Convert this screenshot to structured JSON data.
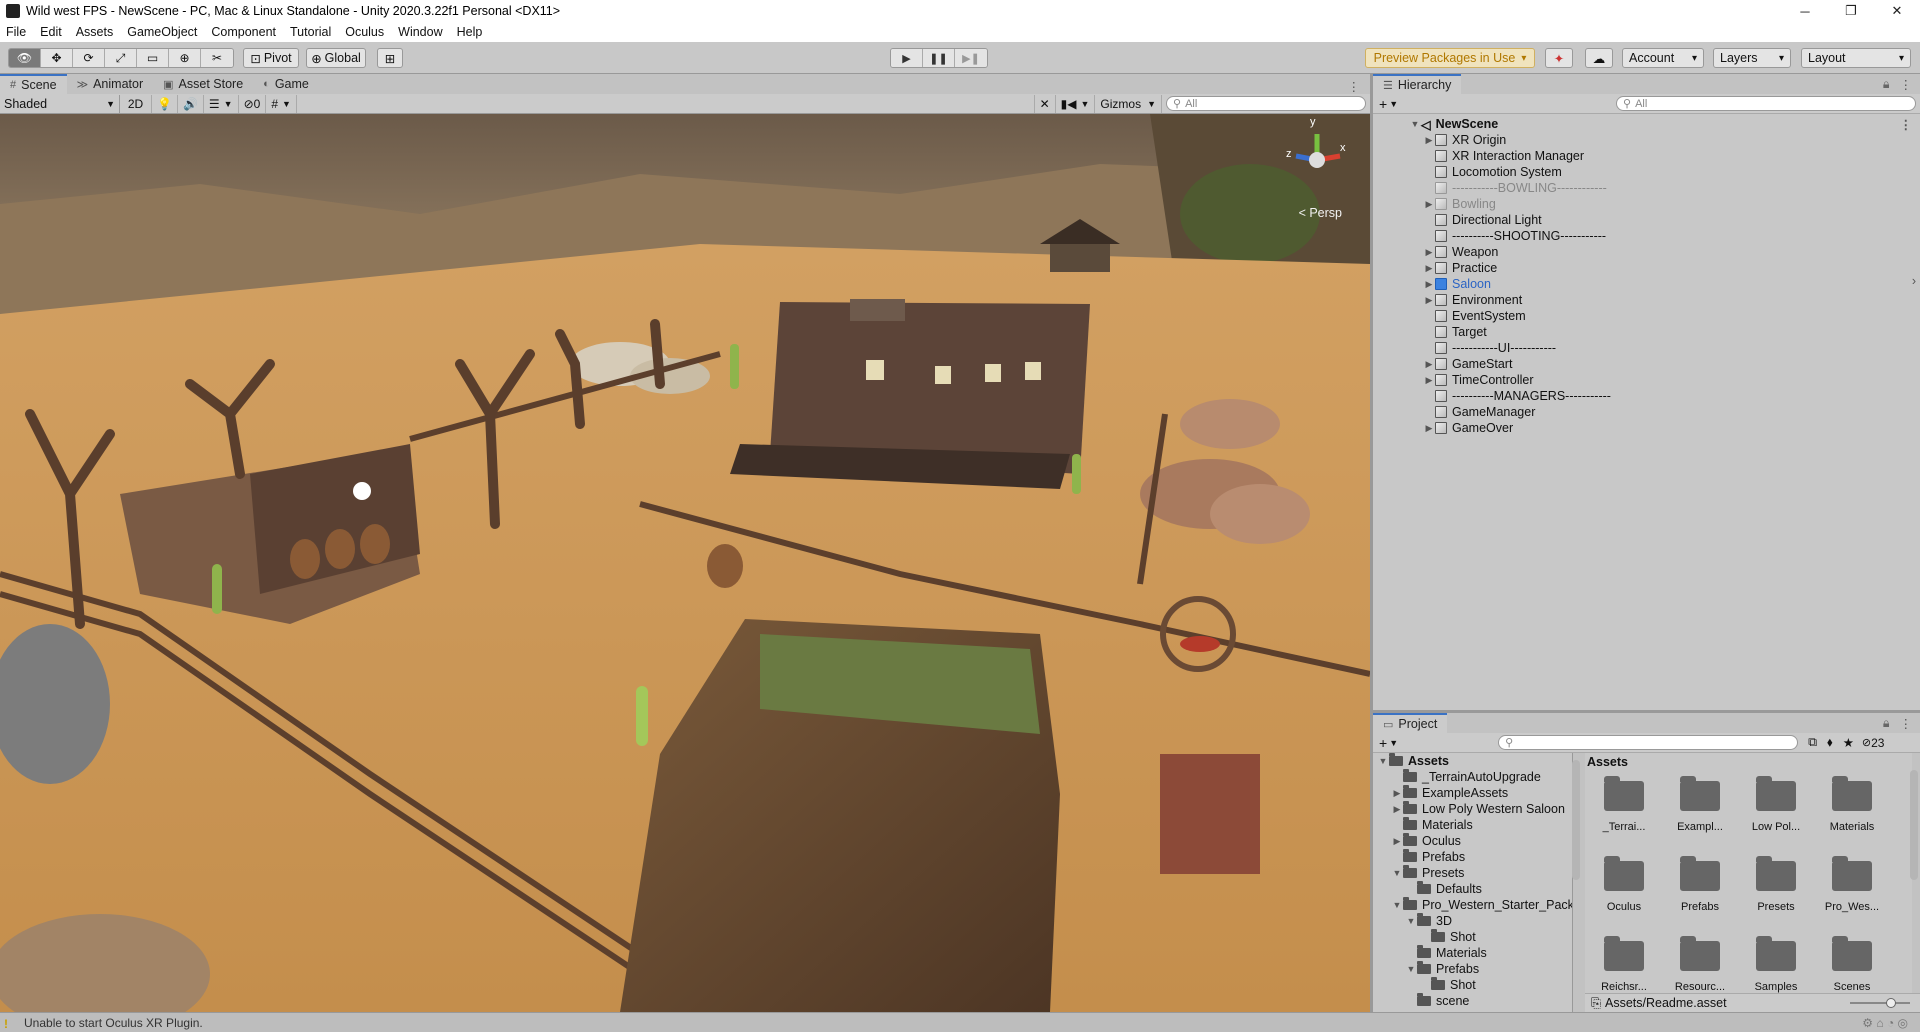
{
  "window": {
    "title": "Wild west FPS - NewScene - PC, Mac & Linux Standalone - Unity 2020.3.22f1 Personal <DX11>",
    "minimize": "─",
    "maximize": "❐",
    "close": "✕"
  },
  "menu": [
    "File",
    "Edit",
    "Assets",
    "GameObject",
    "Component",
    "Tutorial",
    "Oculus",
    "Window",
    "Help"
  ],
  "toolbar": {
    "tools": [
      "view-tool-icon",
      "move-tool-icon",
      "rotate-tool-icon",
      "scale-tool-icon",
      "rect-tool-icon",
      "transform-tool-icon",
      "custom-tool-icon"
    ],
    "tool_glyphs": [
      "👁",
      "✥",
      "⟳",
      "⤢",
      "▭",
      "⊕",
      "✂"
    ],
    "pivot": "Pivot",
    "global": "Global",
    "play_glyphs": [
      "▶",
      "❚❚",
      "▶❚"
    ],
    "preview_packages": "Preview Packages in Use",
    "account": "Account",
    "layers": "Layers",
    "layout": "Layout"
  },
  "scene_tabs": [
    {
      "icon": "#",
      "label": "Scene"
    },
    {
      "icon": "≫",
      "label": "Animator"
    },
    {
      "icon": "▣",
      "label": "Asset Store"
    },
    {
      "icon": "◐",
      "label": "Game"
    }
  ],
  "scene_toolbar": {
    "shading": "Shaded",
    "mode_2d": "2D",
    "hidden_count": "0",
    "gizmos": "Gizmos",
    "search_placeholder": "All"
  },
  "viewport": {
    "persp_label": "< Persp",
    "axis_y": "y",
    "axis_x": "x",
    "axis_z": "z"
  },
  "hierarchy": {
    "tab": "Hierarchy",
    "search_placeholder": "All",
    "scene": "NewScene",
    "items": [
      {
        "label": "XR Origin",
        "expandable": true,
        "style": "normal"
      },
      {
        "label": "XR Interaction Manager",
        "expandable": false,
        "style": "normal"
      },
      {
        "label": "Locomotion System",
        "expandable": false,
        "style": "normal"
      },
      {
        "label": "-----------BOWLING------------",
        "expandable": false,
        "style": "dim"
      },
      {
        "label": "Bowling",
        "expandable": true,
        "style": "dim"
      },
      {
        "label": "Directional Light",
        "expandable": false,
        "style": "normal"
      },
      {
        "label": "----------SHOOTING-----------",
        "expandable": false,
        "style": "normal"
      },
      {
        "label": "Weapon",
        "expandable": true,
        "style": "normal"
      },
      {
        "label": "Practice",
        "expandable": true,
        "style": "normal"
      },
      {
        "label": "Saloon",
        "expandable": true,
        "style": "blue"
      },
      {
        "label": "Environment",
        "expandable": true,
        "style": "normal"
      },
      {
        "label": "EventSystem",
        "expandable": false,
        "style": "normal"
      },
      {
        "label": "Target",
        "expandable": false,
        "style": "normal"
      },
      {
        "label": "-----------UI-----------",
        "expandable": false,
        "style": "normal"
      },
      {
        "label": "GameStart",
        "expandable": true,
        "style": "normal"
      },
      {
        "label": "TimeController",
        "expandable": true,
        "style": "normal"
      },
      {
        "label": "----------MANAGERS-----------",
        "expandable": false,
        "style": "normal"
      },
      {
        "label": "GameManager",
        "expandable": false,
        "style": "normal"
      },
      {
        "label": "GameOver",
        "expandable": true,
        "style": "normal"
      }
    ]
  },
  "project": {
    "tab": "Project",
    "hidden_count": "23",
    "grid_title": "Assets",
    "tree": [
      {
        "label": "Assets",
        "depth": 0,
        "arrow": "▼",
        "bold": true
      },
      {
        "label": "_TerrainAutoUpgrade",
        "depth": 1,
        "arrow": ""
      },
      {
        "label": "ExampleAssets",
        "depth": 1,
        "arrow": "▶"
      },
      {
        "label": "Low Poly Western Saloon",
        "depth": 1,
        "arrow": "▶"
      },
      {
        "label": "Materials",
        "depth": 1,
        "arrow": ""
      },
      {
        "label": "Oculus",
        "depth": 1,
        "arrow": "▶"
      },
      {
        "label": "Prefabs",
        "depth": 1,
        "arrow": ""
      },
      {
        "label": "Presets",
        "depth": 1,
        "arrow": "▼"
      },
      {
        "label": "Defaults",
        "depth": 2,
        "arrow": ""
      },
      {
        "label": "Pro_Western_Starter_Pack",
        "depth": 1,
        "arrow": "▼"
      },
      {
        "label": "3D",
        "depth": 2,
        "arrow": "▼"
      },
      {
        "label": "Shot",
        "depth": 3,
        "arrow": ""
      },
      {
        "label": "Materials",
        "depth": 2,
        "arrow": ""
      },
      {
        "label": "Prefabs",
        "depth": 2,
        "arrow": "▼"
      },
      {
        "label": "Shot",
        "depth": 3,
        "arrow": ""
      },
      {
        "label": "scene",
        "depth": 2,
        "arrow": ""
      }
    ],
    "grid": [
      "_Terrai...",
      "Exampl...",
      "Low Pol...",
      "Materials",
      "Oculus",
      "Prefabs",
      "Presets",
      "Pro_Wes...",
      "Reichsr...",
      "Resourc...",
      "Samples",
      "Scenes"
    ],
    "selected_path": "Assets/Readme.asset"
  },
  "status": {
    "message": "Unable to start Oculus XR Plugin."
  }
}
